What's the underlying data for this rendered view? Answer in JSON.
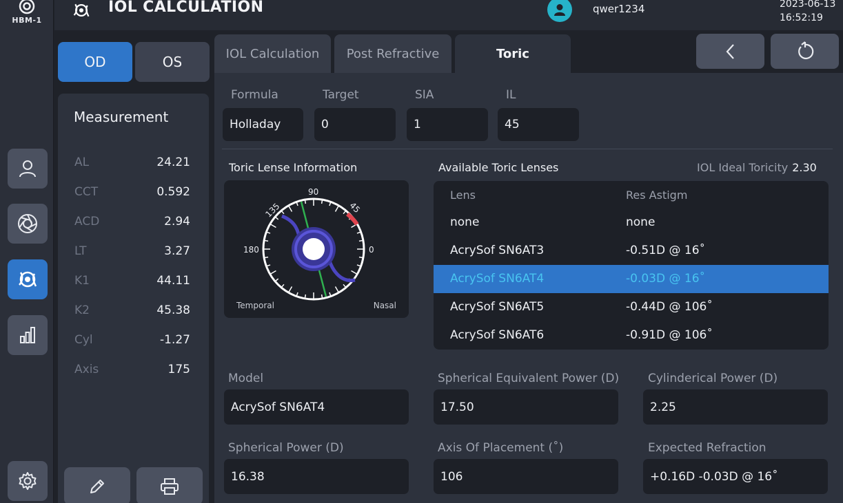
{
  "brand": {
    "model": "HBM-1"
  },
  "header": {
    "title": "IOL CALCULATION",
    "username": "qwer1234",
    "date": "2023-06-13",
    "time": "16:52:19"
  },
  "sidebar": {
    "items": [
      {
        "icon": "user-icon"
      },
      {
        "icon": "aperture-icon"
      },
      {
        "icon": "iol-eye-icon",
        "active": true
      },
      {
        "icon": "bar-chart-icon"
      },
      {
        "icon": "gear-icon"
      }
    ]
  },
  "eye_toggle": {
    "od": "OD",
    "os": "OS",
    "selected": "OD"
  },
  "measurement": {
    "title": "Measurement",
    "rows": [
      {
        "label": "AL",
        "value": "24.21"
      },
      {
        "label": "CCT",
        "value": "0.592"
      },
      {
        "label": "ACD",
        "value": "2.94"
      },
      {
        "label": "LT",
        "value": "3.27"
      },
      {
        "label": "K1",
        "value": "44.11"
      },
      {
        "label": "K2",
        "value": "45.38"
      },
      {
        "label": "Cyl",
        "value": "-1.27"
      },
      {
        "label": "Axis",
        "value": "175"
      }
    ]
  },
  "bottom_buttons": [
    {
      "icon": "pencil-icon"
    },
    {
      "icon": "printer-icon"
    }
  ],
  "tabs": [
    {
      "label": "IOL Calculation"
    },
    {
      "label": "Post Refractive"
    },
    {
      "label": "Toric",
      "active": true
    }
  ],
  "nav": {
    "back_icon": "chevron-left-icon",
    "reset_icon": "rotate-icon"
  },
  "inputs": {
    "formula": {
      "label": "Formula",
      "value": "Holladay"
    },
    "target": {
      "label": "Target",
      "value": "0"
    },
    "sia": {
      "label": "SIA",
      "value": "1"
    },
    "il": {
      "label": "IL",
      "value": "45"
    }
  },
  "toric_info": {
    "title": "Toric Lense Information",
    "dial": {
      "labels": {
        "top": "90",
        "left": "180",
        "right": "0",
        "upper_left": "135",
        "upper_right": "45"
      },
      "temporal": "Temporal",
      "nasal": "Nasal"
    }
  },
  "available": {
    "title": "Available Toric Lenses",
    "ideal_label": "IOL Ideal Toricity",
    "ideal_value": "2.30",
    "headers": {
      "lens": "Lens",
      "res": "Res Astigm"
    },
    "rows": [
      {
        "lens": "none",
        "res": "none"
      },
      {
        "lens": "AcrySof SN6AT3",
        "res": "-0.51D @ 16˚"
      },
      {
        "lens": "AcrySof SN6AT4",
        "res": "-0.03D @ 16˚",
        "selected": true
      },
      {
        "lens": "AcrySof SN6AT5",
        "res": "-0.44D @ 106˚"
      },
      {
        "lens": "AcrySof SN6AT6",
        "res": "-0.91D @ 106˚"
      }
    ]
  },
  "results": {
    "model": {
      "label": "Model",
      "value": "AcrySof SN6AT4"
    },
    "seq_power": {
      "label": "Spherical Equivalent Power (D)",
      "value": "17.50"
    },
    "cyl_power": {
      "label": "Cylinderical Power (D)",
      "value": "2.25"
    },
    "sph_power": {
      "label": "Spherical Power (D)",
      "value": "16.38"
    },
    "axis_placement": {
      "label": "Axis Of Placement (˚)",
      "value": "106"
    },
    "expected_refraction": {
      "label": "Expected Refraction",
      "value": "+0.16D -0.03D @ 16˚"
    }
  },
  "colors": {
    "accent": "#2f76c9",
    "selected_text": "#48c4f0",
    "avatar": "#26b3c9",
    "dial_red": "#e0454f",
    "dial_green": "#2fb04f",
    "dial_purple": "#4b45c0"
  }
}
